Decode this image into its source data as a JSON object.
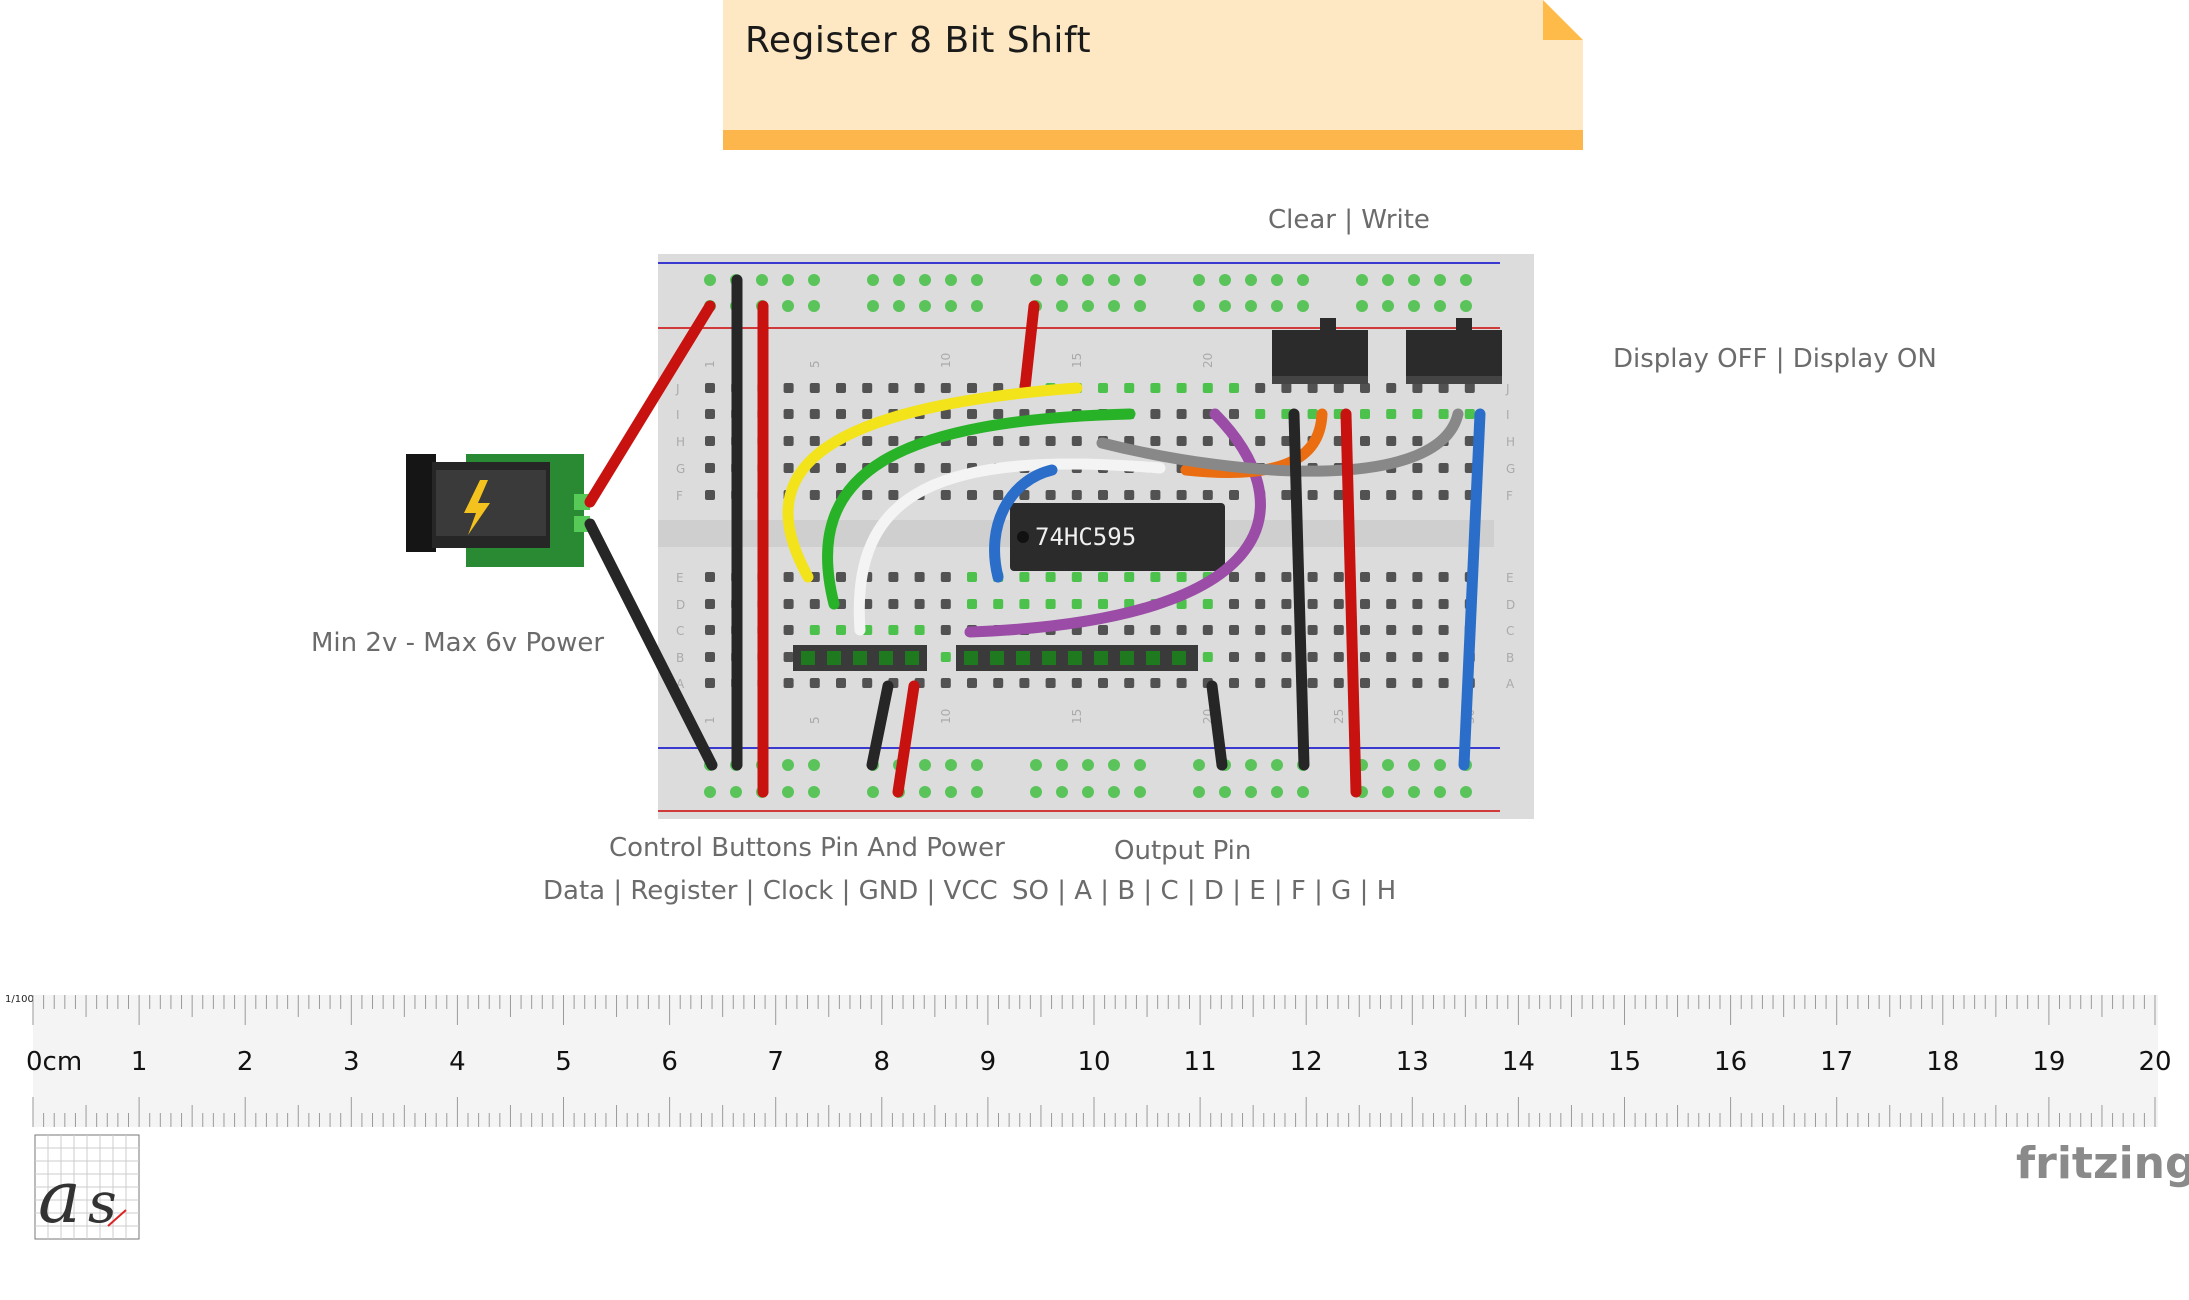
{
  "note": {
    "title": "Register 8 Bit Shift"
  },
  "labels": {
    "switches": "Clear |  Write",
    "display": "Display OFF | Display ON",
    "power": "Min 2v - Max 6v Power",
    "control_title": "Control Buttons Pin And Power",
    "control_pins": "Data | Register | Clock | GND | VCC",
    "output_title": "Output Pin",
    "output_pins": "SO | A | B | C | D | E | F | G | H"
  },
  "chip": {
    "label": "74HC595"
  },
  "breadboard": {
    "row_letters_top": [
      "J",
      "I",
      "H",
      "G",
      "F"
    ],
    "row_letters_bottom": [
      "E",
      "D",
      "C",
      "B",
      "A"
    ],
    "column_numbers": [
      "1",
      "5",
      "10",
      "15",
      "20",
      "25",
      "30"
    ]
  },
  "ruler": {
    "scale": "1/100",
    "unit_label": "0cm",
    "numbers": [
      "1",
      "2",
      "3",
      "4",
      "5",
      "6",
      "7",
      "8",
      "9",
      "10",
      "11",
      "12",
      "13",
      "14",
      "15",
      "16",
      "17",
      "18",
      "19",
      "20"
    ]
  },
  "brand": {
    "name": "fritzing"
  },
  "colors": {
    "wire_red": "#c8120f",
    "wire_black": "#262626",
    "wire_yellow": "#f2e31a",
    "wire_green": "#27b227",
    "wire_white": "#f4f4f4",
    "wire_blue": "#2a6ec9",
    "wire_orange": "#ea6d12",
    "wire_gray": "#888888",
    "wire_purple": "#9a4ca6",
    "breadboard": "#dcdcdc",
    "jack_pcb": "#2a8a33"
  }
}
